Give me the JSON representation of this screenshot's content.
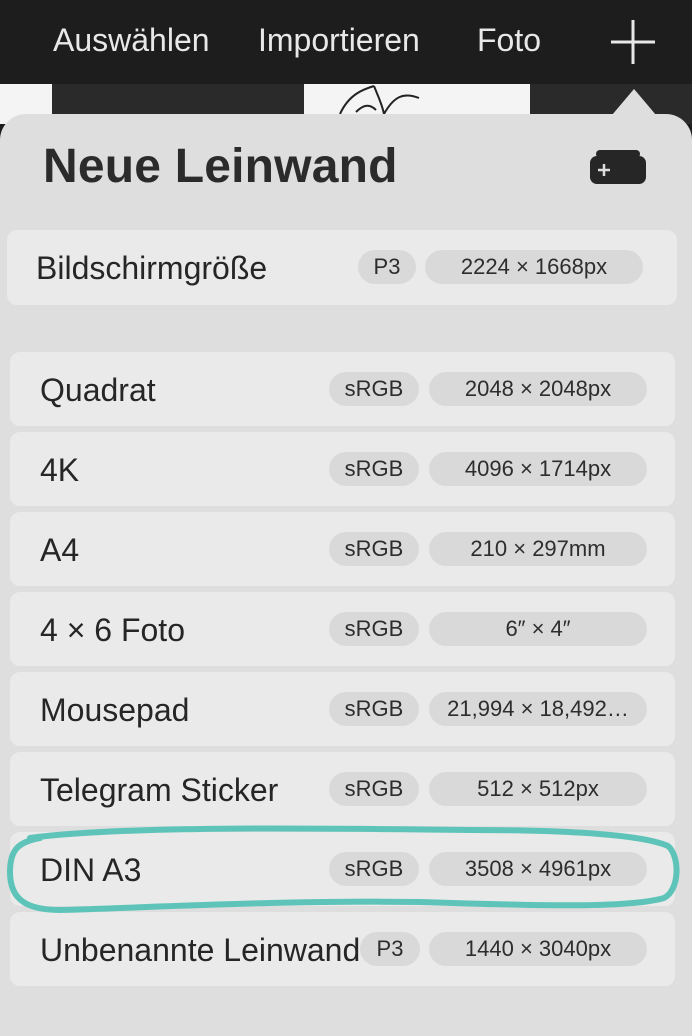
{
  "toolbar": {
    "select_label": "Auswählen",
    "import_label": "Importieren",
    "photo_label": "Foto"
  },
  "popover": {
    "title": "Neue Leinwand"
  },
  "screen_row": {
    "name": "Bildschirmgröße",
    "profile": "P3",
    "size": "2224 × 1668px"
  },
  "canvases": [
    {
      "name": "Quadrat",
      "profile": "sRGB",
      "size": "2048 × 2048px"
    },
    {
      "name": "4K",
      "profile": "sRGB",
      "size": "4096 × 1714px"
    },
    {
      "name": "A4",
      "profile": "sRGB",
      "size": "210 × 297mm"
    },
    {
      "name": "4 × 6 Foto",
      "profile": "sRGB",
      "size": "6″ × 4″"
    },
    {
      "name": "Mousepad",
      "profile": "sRGB",
      "size": "21,994 × 18,492…"
    },
    {
      "name": "Telegram Sticker",
      "profile": "sRGB",
      "size": "512 × 512px"
    },
    {
      "name": "DIN A3",
      "profile": "sRGB",
      "size": "3508 × 4961px"
    },
    {
      "name": "Unbenannte Leinwand",
      "profile": "P3",
      "size": "1440 × 3040px"
    }
  ],
  "colors": {
    "highlight": "#5ec4ba"
  }
}
